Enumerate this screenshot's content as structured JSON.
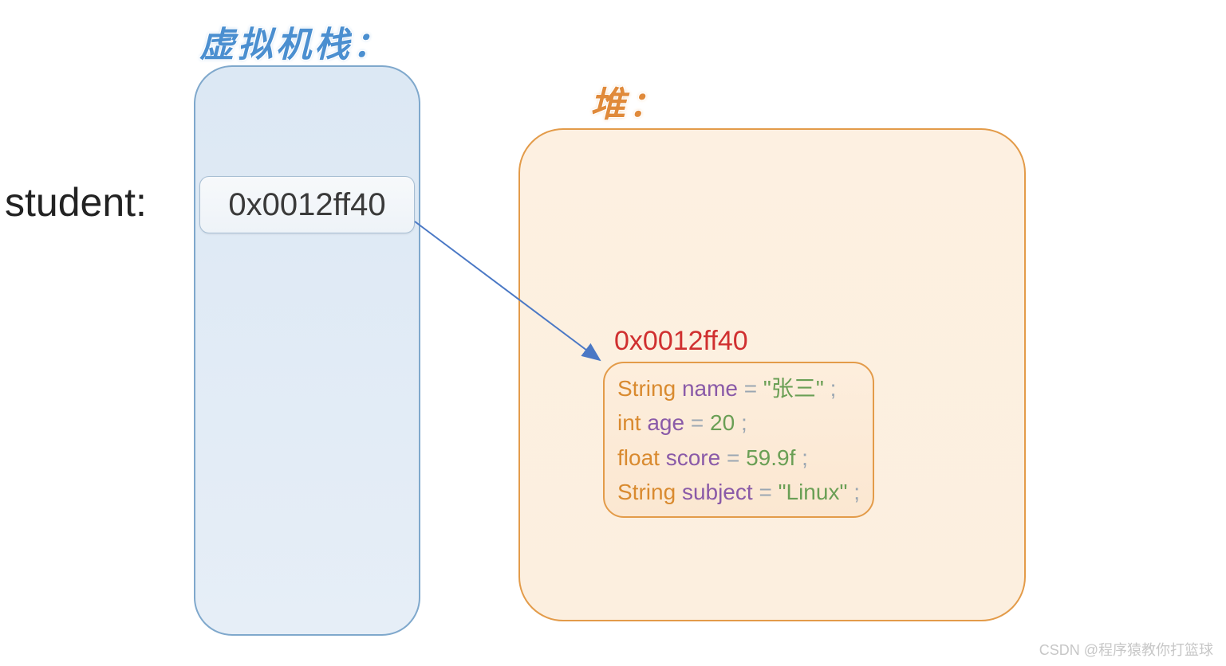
{
  "stack": {
    "title": "虚拟机栈：",
    "varLabel": "student:",
    "cellValue": "0x0012ff40"
  },
  "heap": {
    "title": "堆：",
    "objectAddress": "0x0012ff40",
    "fields": [
      {
        "type": "String",
        "name": "name",
        "eq": " = ",
        "value": "\"张三\"",
        "semi": ";"
      },
      {
        "type": "int",
        "name": "age",
        "eq": " = ",
        "value": "20",
        "semi": ";"
      },
      {
        "type": "float",
        "name": "score",
        "eq": " = ",
        "value": "59.9f",
        "semi": ";"
      },
      {
        "type": "String",
        "name": "subject",
        "eq": " = ",
        "value": "\"Linux\"",
        "semi": ";"
      }
    ]
  },
  "watermark": "CSDN @程序猿教你打篮球"
}
